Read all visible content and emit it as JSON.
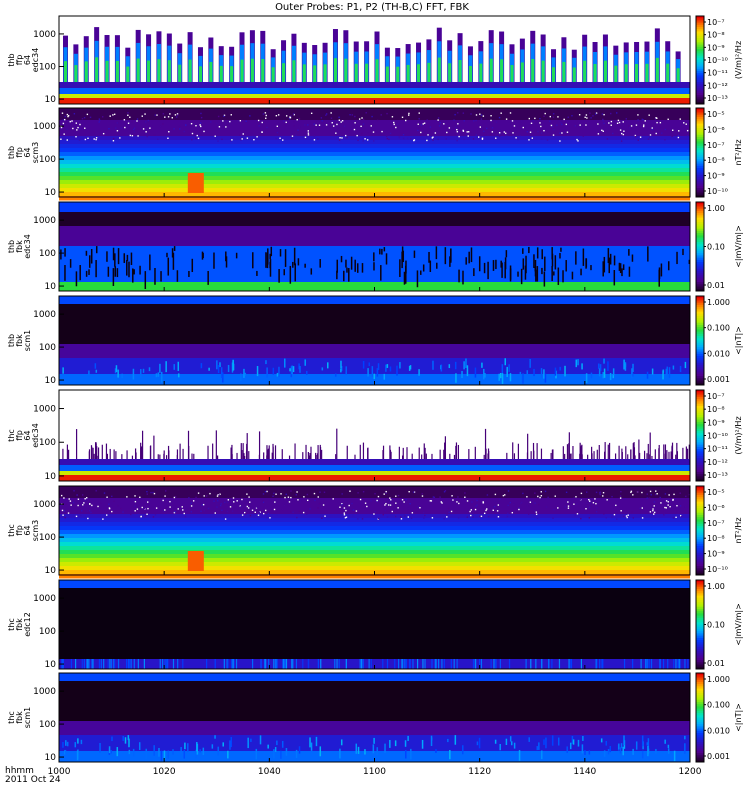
{
  "title": "Outer Probes: P1, P2 (TH-B,C) FFT, FBK",
  "time_axis": {
    "label_line1": "hhmm",
    "label_line2": "2011 Oct 24",
    "ticks": [
      "1000",
      "1020",
      "1040",
      "1100",
      "1120",
      "1140",
      "1200"
    ]
  },
  "chart_data": {
    "type": "heatmap",
    "title": "Outer Probes: P1, P2 (TH-B,C) FFT, FBK",
    "x_range": [
      "10:00",
      "12:00"
    ],
    "panels": [
      {
        "id": "thb-ffp-edc34",
        "ylabel": [
          "thb",
          "ffp",
          "64",
          "edc34"
        ],
        "y_scale": "log",
        "y_ticks": [
          "10",
          "100",
          "1000"
        ],
        "colorbar": {
          "unit": "(V/m)²/Hz",
          "ticks": [
            "10⁻⁷",
            "10⁻⁸",
            "10⁻⁹",
            "10⁻¹⁰",
            "10⁻¹¹",
            "10⁻¹²",
            "10⁻¹³"
          ]
        },
        "pattern": "ffp-edc"
      },
      {
        "id": "thb-ffp-scm3",
        "ylabel": [
          "thb",
          "ffp",
          "64",
          "scm3"
        ],
        "y_scale": "log",
        "y_ticks": [
          "10",
          "100",
          "1000"
        ],
        "colorbar": {
          "unit": "nT²/Hz",
          "ticks": [
            "10⁻⁵",
            "10⁻⁶",
            "10⁻⁷",
            "10⁻⁸",
            "10⁻⁹",
            "10⁻¹⁰"
          ]
        },
        "pattern": "ffp-scm"
      },
      {
        "id": "thb-fbk-edc34",
        "ylabel": [
          "thb",
          "fbk",
          "edc34"
        ],
        "y_scale": "log",
        "y_ticks": [
          "10",
          "100",
          "1000"
        ],
        "colorbar": {
          "unit": "<|mV/m|>",
          "ticks": [
            "1.00",
            "0.10",
            "0.01"
          ]
        },
        "pattern": "fbk-edc"
      },
      {
        "id": "thb-fbk-scm1",
        "ylabel": [
          "thb",
          "fbk",
          "scm1"
        ],
        "y_scale": "log",
        "y_ticks": [
          "10",
          "100",
          "1000"
        ],
        "colorbar": {
          "unit": "<|nT|>",
          "ticks": [
            "1.000",
            "0.100",
            "0.010",
            "0.001"
          ]
        },
        "pattern": "fbk-scm"
      },
      {
        "id": "thc-ffp-edc34",
        "ylabel": [
          "thc",
          "ffp",
          "64",
          "edc34"
        ],
        "y_scale": "log",
        "y_ticks": [
          "10",
          "100",
          "1000"
        ],
        "colorbar": {
          "unit": "(V/m)²/Hz",
          "ticks": [
            "10⁻⁷",
            "10⁻⁸",
            "10⁻⁹",
            "10⁻¹⁰",
            "10⁻¹¹",
            "10⁻¹²",
            "10⁻¹³"
          ]
        },
        "pattern": "ffp-edc-quiet"
      },
      {
        "id": "thc-ffp-scm3",
        "ylabel": [
          "thc",
          "ffp",
          "64",
          "scm3"
        ],
        "y_scale": "log",
        "y_ticks": [
          "10",
          "100",
          "1000"
        ],
        "colorbar": {
          "unit": "nT²/Hz",
          "ticks": [
            "10⁻⁵",
            "10⁻⁶",
            "10⁻⁷",
            "10⁻⁸",
            "10⁻⁹",
            "10⁻¹⁰"
          ]
        },
        "pattern": "ffp-scm"
      },
      {
        "id": "thc-fbk-edc12",
        "ylabel": [
          "thc",
          "fbk",
          "edc12"
        ],
        "y_scale": "log",
        "y_ticks": [
          "10",
          "100",
          "1000"
        ],
        "colorbar": {
          "unit": "<|mV/m|>",
          "ticks": [
            "1.00",
            "0.10",
            "0.01"
          ]
        },
        "pattern": "fbk-dark"
      },
      {
        "id": "thc-fbk-scm1",
        "ylabel": [
          "thc",
          "fbk",
          "scm1"
        ],
        "y_scale": "log",
        "y_ticks": [
          "10",
          "100",
          "1000"
        ],
        "colorbar": {
          "unit": "<|nT|>",
          "ticks": [
            "1.000",
            "0.100",
            "0.010",
            "0.001"
          ]
        },
        "pattern": "fbk-scm"
      }
    ]
  }
}
